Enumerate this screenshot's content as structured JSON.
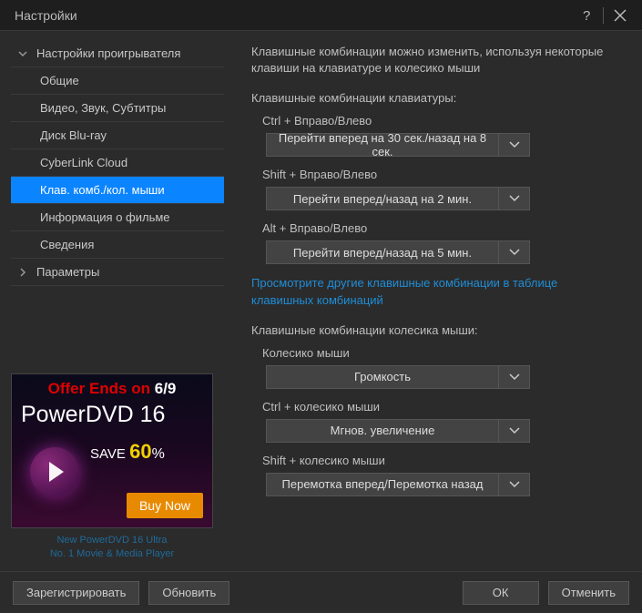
{
  "window": {
    "title": "Настройки"
  },
  "sidebar": {
    "items": [
      {
        "label": "Настройки проигрывателя",
        "level": "top",
        "expanded": true
      },
      {
        "label": "Общие",
        "level": "child"
      },
      {
        "label": "Видео, Звук, Субтитры",
        "level": "child"
      },
      {
        "label": "Диск Blu-ray",
        "level": "child"
      },
      {
        "label": "CyberLink Cloud",
        "level": "child"
      },
      {
        "label": "Клав. комб./кол. мыши",
        "level": "child",
        "selected": true
      },
      {
        "label": "Информация о фильме",
        "level": "child"
      },
      {
        "label": "Сведения",
        "level": "child"
      },
      {
        "label": "Параметры",
        "level": "top",
        "expanded": false
      }
    ]
  },
  "ad": {
    "line1_a": "Offer Ends on ",
    "line1_b": "6/9",
    "line2": "PowerDVD 16",
    "save_a": "SAVE ",
    "save_b": "60",
    "save_c": "%",
    "buy": "Buy Now",
    "caption1": "New PowerDVD 16 Ultra",
    "caption2": "No. 1 Movie & Media Player"
  },
  "main": {
    "intro": "Клавишные комбинации можно изменить, используя некоторые клавиши на клавиатуре и колесико мыши",
    "kb_section": "Клавишные комбинации клавиатуры:",
    "groups_kb": [
      {
        "label": "Ctrl + Вправо/Влево",
        "value": "Перейти вперед на 30 сек./назад на 8 сек."
      },
      {
        "label": "Shift + Вправо/Влево",
        "value": "Перейти вперед/назад на 2 мин."
      },
      {
        "label": "Alt + Вправо/Влево",
        "value": "Перейти вперед/назад на 5 мин."
      }
    ],
    "link": "Просмотрите другие клавишные комбинации в таблице клавишных комбинаций",
    "wheel_section": "Клавишные комбинации колесика мыши:",
    "groups_wheel": [
      {
        "label": "Колесико мыши",
        "value": "Громкость"
      },
      {
        "label": "Ctrl + колесико мыши",
        "value": "Мгнов. увеличение"
      },
      {
        "label": "Shift + колесико мыши",
        "value": "Перемотка вперед/Перемотка назад"
      }
    ]
  },
  "footer": {
    "register": "Зарегистрировать",
    "update": "Обновить",
    "ok": "ОК",
    "cancel": "Отменить"
  }
}
